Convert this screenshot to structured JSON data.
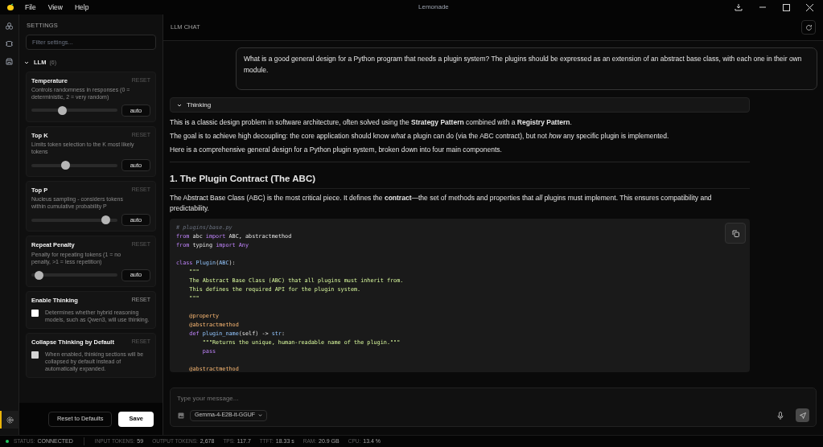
{
  "menu": [
    "File",
    "View",
    "Help"
  ],
  "window": {
    "title": "Lemonade"
  },
  "settings": {
    "title": "SETTINGS",
    "filter_placeholder": "Filter settings...",
    "group": {
      "label": "LLM",
      "count": "(6)",
      "expanded": true
    },
    "items": [
      {
        "kind": "slider",
        "title": "Temperature",
        "description": "Controls randomness in responses (0 = deterministic, 2 = very random)",
        "reset": "RESET",
        "reset_disabled": true,
        "level": 0.36,
        "value": "auto"
      },
      {
        "kind": "slider",
        "title": "Top K",
        "description": "Limits token selection to the K most likely tokens",
        "reset": "RESET",
        "reset_disabled": true,
        "level": 0.4,
        "value": "auto"
      },
      {
        "kind": "slider",
        "title": "Top P",
        "description": "Nucleus sampling - considers tokens within cumulative probability P",
        "reset": "RESET",
        "reset_disabled": true,
        "level": 0.86,
        "value": "auto"
      },
      {
        "kind": "slider",
        "title": "Repeat Penalty",
        "description": "Penalty for repeating tokens (1 = no penalty, >1 = less repetition)",
        "reset": "RESET",
        "reset_disabled": true,
        "level": 0.09,
        "value": "auto"
      },
      {
        "kind": "checkbox",
        "title": "Enable Thinking",
        "description": "Determines whether hybrid reasoning models, such as Qwen3, will use thinking.",
        "reset": "RESET",
        "reset_disabled": false,
        "checked": false
      },
      {
        "kind": "checkbox",
        "title": "Collapse Thinking by Default",
        "description": "When enabled, thinking sections will be collapsed by default instead of automatically expanded.",
        "reset": "RESET",
        "reset_disabled": true,
        "checked": false
      }
    ],
    "buttons": [
      "Reset to Defaults",
      "Save"
    ]
  },
  "chat": {
    "title": "LLM CHAT",
    "user_message": "What is a good general design for a Python program that needs a plugin system? The plugins should be expressed as an extension of an abstract base class, with each one in their own module.",
    "thinking": {
      "label": "Thinking",
      "expanded": false
    },
    "paragraphs": [
      "This is a classic design problem in software architecture, often solved using the **Strategy Pattern** combined with a **Registry Pattern**.",
      "The goal is to achieve high decoupling: the core application should know *what* a plugin can do (via the ABC contract), but not *how* any specific plugin is implemented.",
      "Here is a comprehensive general design for a Python plugin system, broken down into four main components."
    ],
    "heading": "1. The Plugin Contract (The ABC)",
    "heading_paragraph": "The Abstract Base Class (ABC) is the most critical piece. It defines the **contract**—the set of methods and properties that *all* plugins must implement. This ensures compatibility and predictability.",
    "code": [
      {
        "tokens": [
          {
            "kind": "comment",
            "text": "# plugins/base.py"
          }
        ]
      },
      {
        "tokens": [
          {
            "kind": "keyword",
            "text": "from"
          },
          {
            "kind": "plain",
            "text": " abc "
          },
          {
            "kind": "keyword",
            "text": "import"
          },
          {
            "kind": "plain",
            "text": " ABC, abstractmethod"
          }
        ]
      },
      {
        "tokens": [
          {
            "kind": "keyword",
            "text": "from"
          },
          {
            "kind": "plain",
            "text": " typing "
          },
          {
            "kind": "keyword",
            "text": "import Any"
          }
        ]
      },
      {
        "gap_before": true,
        "tokens": [
          {
            "kind": "keyword",
            "text": "class "
          },
          {
            "kind": "name",
            "text": "Plugin"
          },
          {
            "kind": "plain",
            "text": "("
          },
          {
            "kind": "name",
            "text": "ABC"
          },
          {
            "kind": "plain",
            "text": "):"
          }
        ]
      },
      {
        "tokens": [
          {
            "kind": "string",
            "text": "    \"\"\""
          }
        ]
      },
      {
        "tokens": [
          {
            "kind": "string",
            "text": "    The Abstract Base Class (ABC) that all plugins must inherit from."
          }
        ]
      },
      {
        "tokens": [
          {
            "kind": "string",
            "text": "    This defines the required API for the plugin system."
          }
        ]
      },
      {
        "tokens": [
          {
            "kind": "string",
            "text": "    \"\"\""
          }
        ]
      },
      {
        "gap_before": true,
        "tokens": [
          {
            "kind": "decorator",
            "text": "    @property"
          }
        ]
      },
      {
        "tokens": [
          {
            "kind": "decorator",
            "text": "    @abstractmethod"
          }
        ]
      },
      {
        "tokens": [
          {
            "kind": "keyword",
            "text": "    def "
          },
          {
            "kind": "name",
            "text": "plugin_name"
          },
          {
            "kind": "plain",
            "text": "(self) -> "
          },
          {
            "kind": "name",
            "text": "str"
          },
          {
            "kind": "plain",
            "text": ":"
          }
        ]
      },
      {
        "tokens": [
          {
            "kind": "string",
            "text": "        \"\"\"Returns the unique, human-readable name of the plugin.\"\"\""
          }
        ]
      },
      {
        "tokens": [
          {
            "kind": "keyword",
            "text": "        pass"
          }
        ]
      },
      {
        "gap_before": true,
        "tokens": [
          {
            "kind": "decorator",
            "text": "    @abstractmethod"
          }
        ]
      }
    ],
    "input_placeholder": "Type your message...",
    "model": "Gemma-4-E2B-it-GGUF"
  },
  "status_bar": [
    {
      "label": "STATUS:",
      "value": "CONNECTED",
      "kind": "status",
      "color": "#22c55e"
    },
    {
      "label": "INPUT TOKENS:",
      "value": "59"
    },
    {
      "label": "OUTPUT TOKENS:",
      "value": "2,678"
    },
    {
      "label": "TPS:",
      "value": "117.7"
    },
    {
      "label": "TTFT:",
      "value": "18.33 s"
    },
    {
      "label": "RAM:",
      "value": "20.9 GB"
    },
    {
      "label": "CPU:",
      "value": "13.4 %"
    }
  ]
}
